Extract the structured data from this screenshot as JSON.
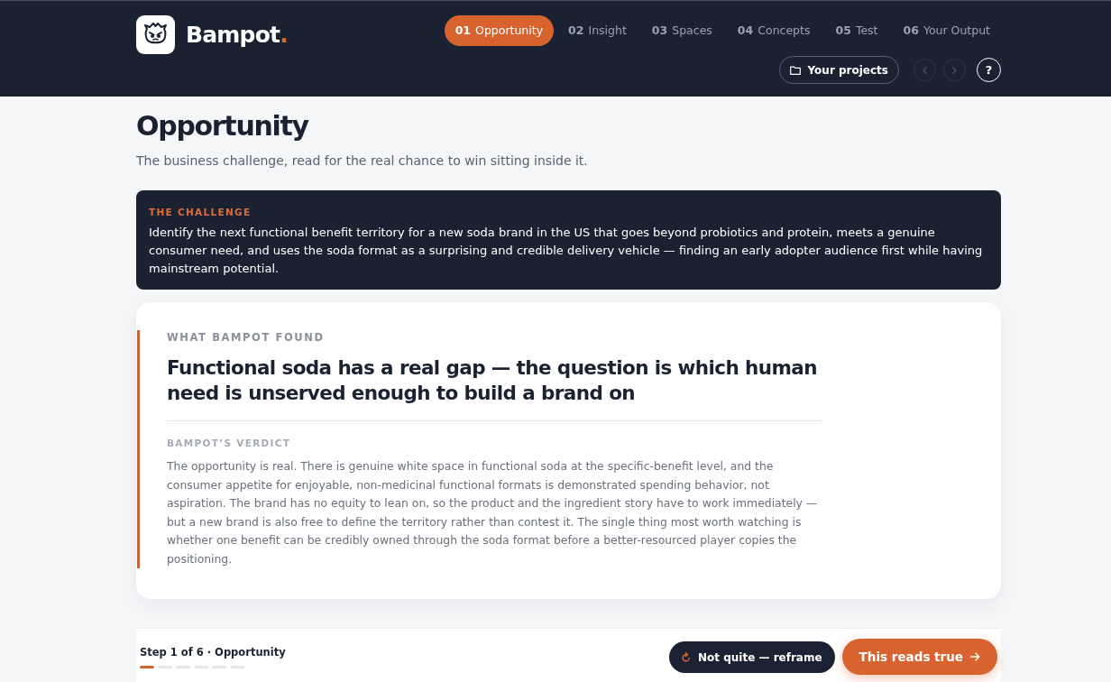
{
  "header": {
    "brand": {
      "name": "Bampot",
      "mark": "."
    },
    "tabs": [
      {
        "number": "01",
        "label": "Opportunity",
        "selected": true
      },
      {
        "number": "02",
        "label": "Insight",
        "selected": false
      },
      {
        "number": "03",
        "label": "Spaces",
        "selected": false
      },
      {
        "number": "04",
        "label": "Concepts",
        "selected": false
      },
      {
        "number": "05",
        "label": "Test",
        "selected": false
      },
      {
        "number": "06",
        "label": "Your Output",
        "selected": false
      }
    ],
    "projects_button": {
      "label": "Your projects"
    },
    "history_buttons": [
      {
        "kind": "back",
        "disabled": true
      },
      {
        "kind": "forward",
        "disabled": true
      }
    ],
    "help_button": {
      "label": "?"
    }
  },
  "page": {
    "title": "Opportunity",
    "subtitle": "The business challenge, read for the real chance to win sitting inside it."
  },
  "challenge": {
    "label": "THE CHALLENGE",
    "text": "Identify the next functional benefit territory for a new soda brand in the US that goes beyond probiotics and protein, meets a genuine consumer need, and uses the soda format as a surprising and credible delivery vehicle — finding an early adopter audience first while having mainstream potential."
  },
  "finding": {
    "eyebrow": "WHAT BAMPOT FOUND",
    "headline": "Functional soda has a real gap — the question is which human need is unserved enough to build a brand on",
    "verdict_label": "BAMPOT’S VERDICT",
    "verdict": "The opportunity is real. There is genuine white space in functional soda at the specific-benefit level, and the consumer appetite for enjoyable, non-medicinal functional formats is demonstrated spending behavior, not aspiration. The brand has no equity to lean on, so the product and the ingredient story have to work immediately — but a new brand is also free to define the territory rather than contest it. The single thing most worth watching is whether one benefit can be credibly owned through the soda format before a better-resourced player copies the positioning."
  },
  "footer": {
    "step_text": "Step 1 of 6 · Opportunity",
    "steps": [
      {
        "done": true
      },
      {
        "done": false
      },
      {
        "done": false
      },
      {
        "done": false
      },
      {
        "done": false
      },
      {
        "done": false
      }
    ],
    "buttons": [
      {
        "kind": "secondary",
        "label": "Not quite — reframe"
      },
      {
        "kind": "primary",
        "label": "This reads true"
      }
    ]
  }
}
